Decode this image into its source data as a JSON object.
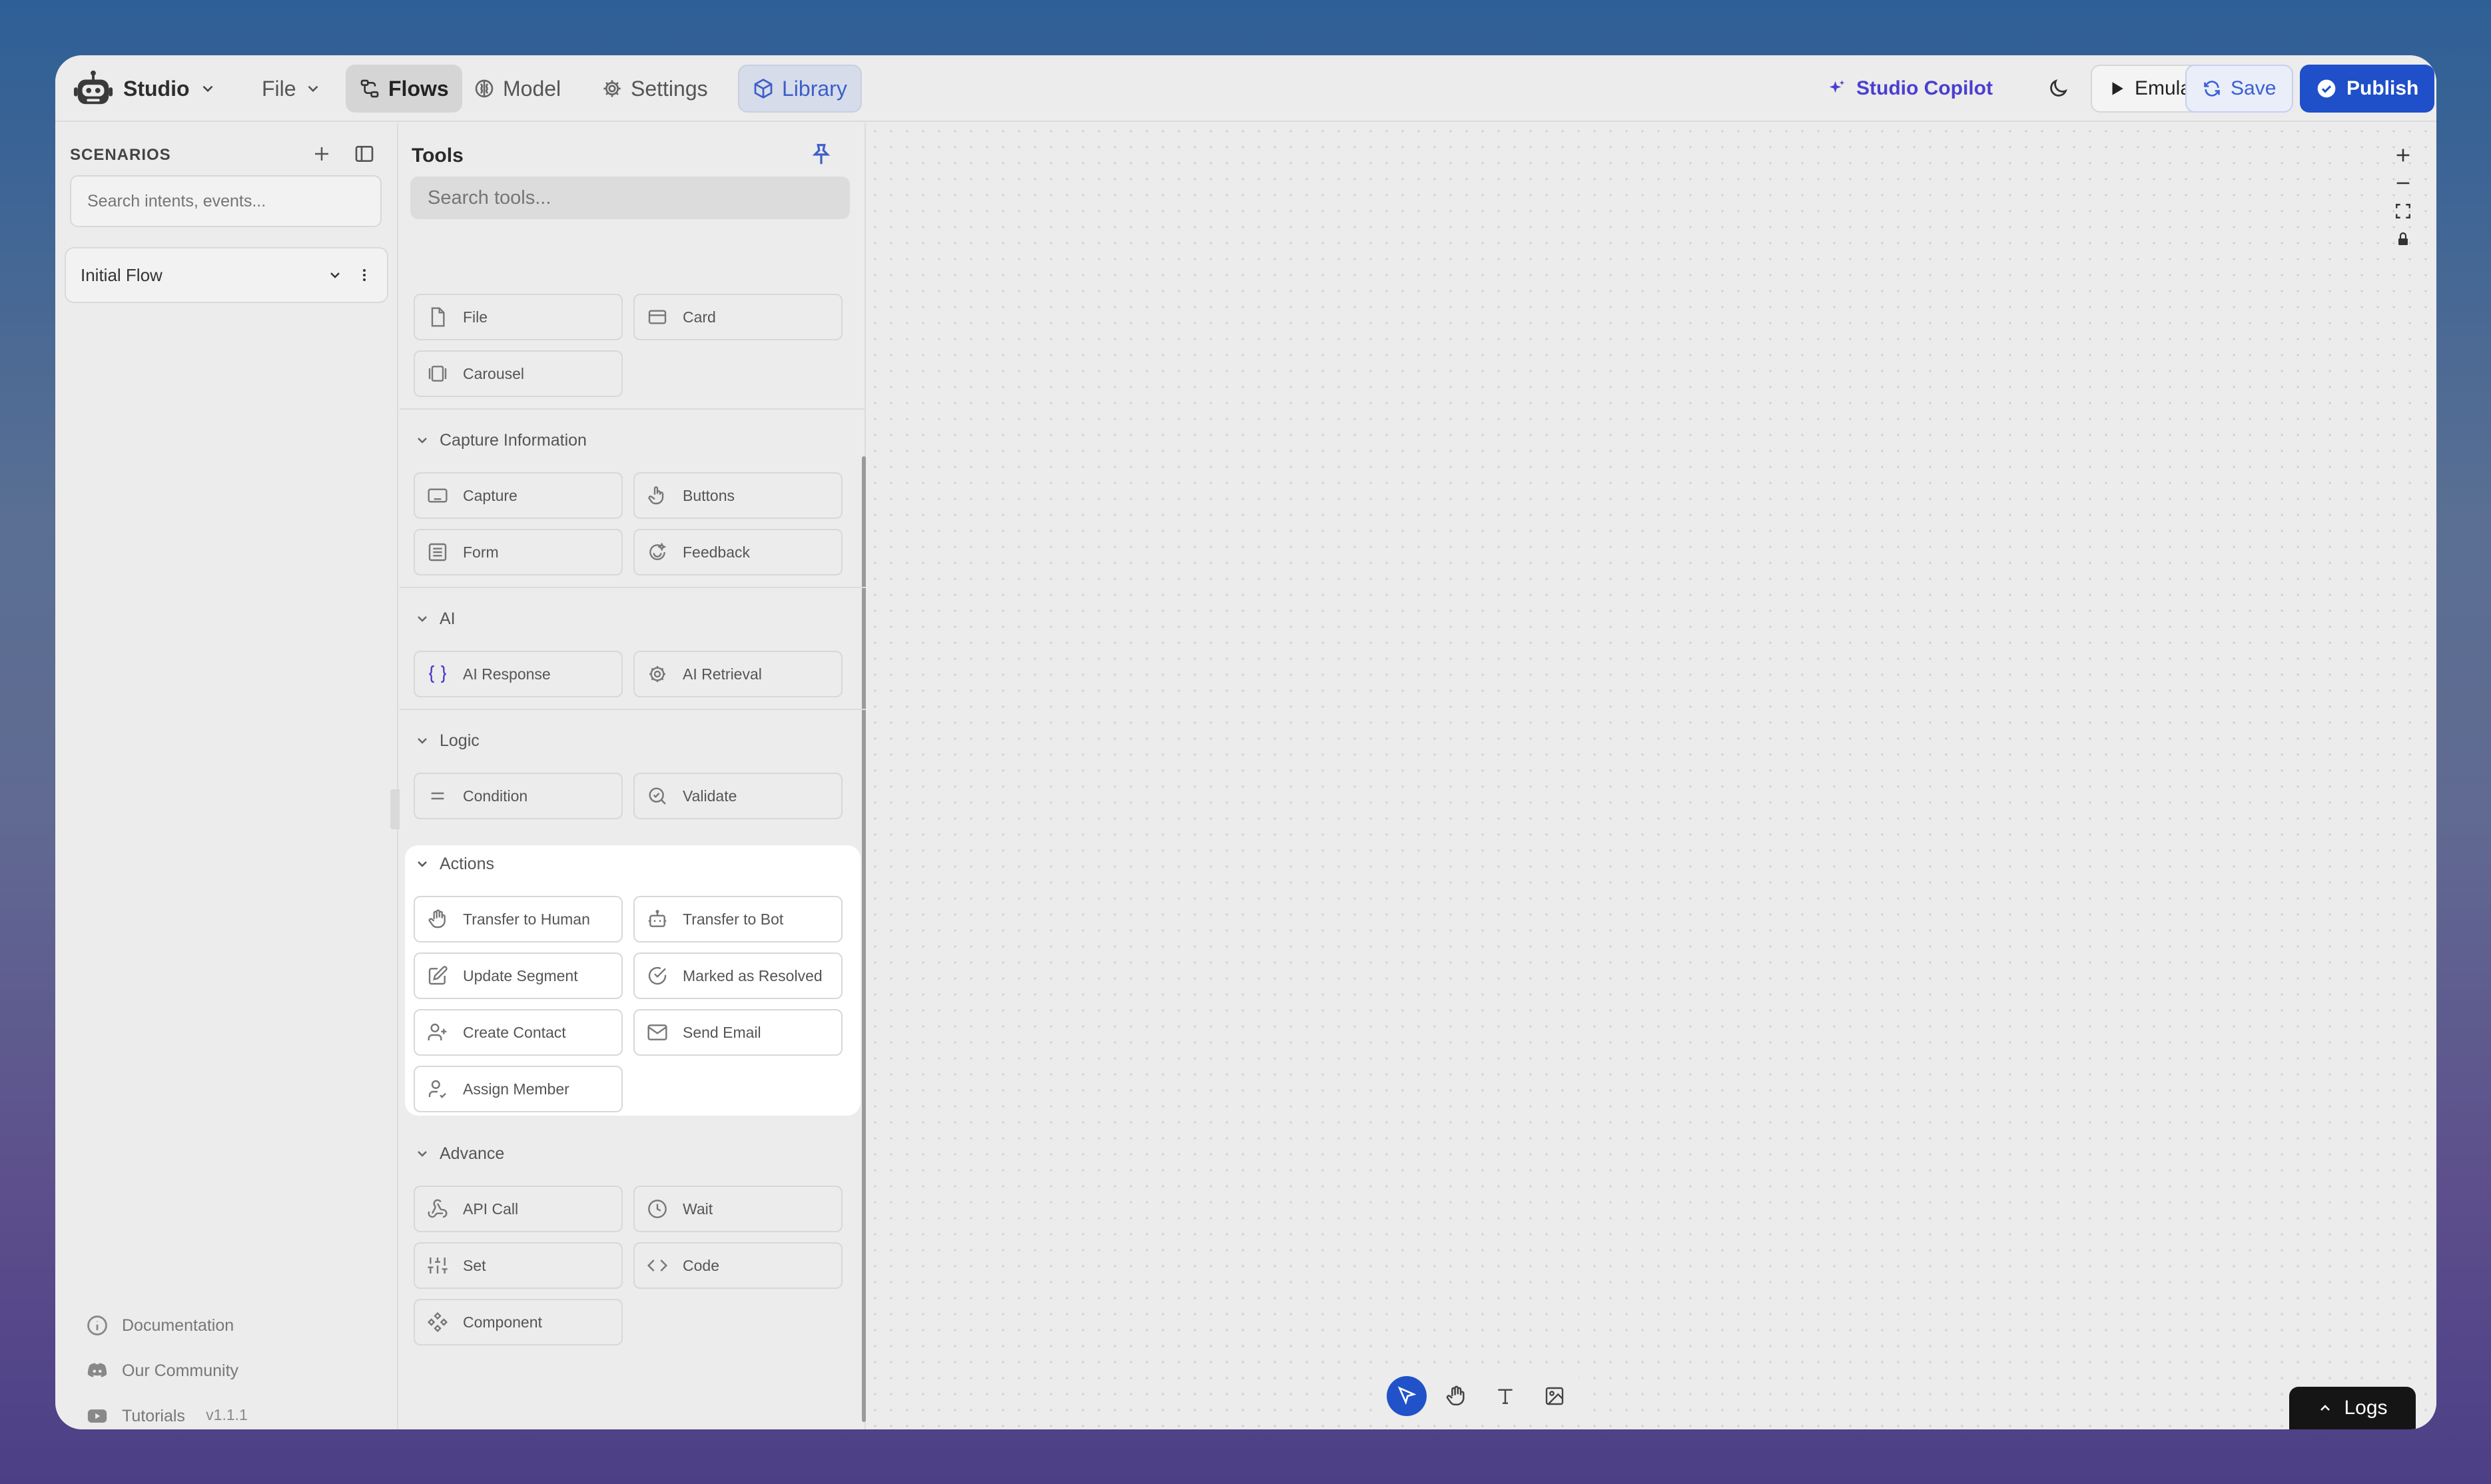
{
  "app": {
    "name": "Studio",
    "version": "v1.1.1"
  },
  "topbar": {
    "file_label": "File",
    "tabs": [
      {
        "label": "Flows",
        "icon": "flows-icon"
      },
      {
        "label": "Model",
        "icon": "brain-icon"
      },
      {
        "label": "Settings",
        "icon": "gear-icon"
      },
      {
        "label": "Library",
        "icon": "package-icon"
      }
    ],
    "copilot_label": "Studio Copilot",
    "emulator_label": "Emulator",
    "save_label": "Save",
    "publish_label": "Publish",
    "accent_color": "#1f4fc9",
    "copilot_color": "#4b3fcf"
  },
  "sidebar": {
    "title": "SCENARIOS",
    "search_placeholder": "Search intents, events...",
    "flows": [
      {
        "label": "Initial Flow"
      }
    ],
    "links": [
      {
        "label": "Documentation",
        "icon": "info-icon"
      },
      {
        "label": "Our Community",
        "icon": "discord-icon"
      },
      {
        "label": "Tutorials",
        "icon": "youtube-icon"
      }
    ]
  },
  "tools": {
    "title": "Tools",
    "search_placeholder": "Search tools...",
    "top_items": [
      {
        "label": "File",
        "icon": "file-icon"
      },
      {
        "label": "Card",
        "icon": "card-icon"
      },
      {
        "label": "Carousel",
        "icon": "carousel-icon"
      }
    ],
    "sections": [
      {
        "title": "Capture Information",
        "items": [
          {
            "label": "Capture",
            "icon": "keyboard-icon"
          },
          {
            "label": "Buttons",
            "icon": "pointer-hand-icon"
          },
          {
            "label": "Form",
            "icon": "form-icon"
          },
          {
            "label": "Feedback",
            "icon": "feedback-icon"
          }
        ]
      },
      {
        "title": "AI",
        "items": [
          {
            "label": "AI Response",
            "icon": "braces-icon"
          },
          {
            "label": "AI Retrieval",
            "icon": "retrieval-icon"
          }
        ]
      },
      {
        "title": "Logic",
        "items": [
          {
            "label": "Condition",
            "icon": "equals-icon"
          },
          {
            "label": "Validate",
            "icon": "search-check-icon"
          }
        ]
      },
      {
        "title": "Actions",
        "highlighted": true,
        "items": [
          {
            "label": "Transfer to Human",
            "icon": "hand-icon"
          },
          {
            "label": "Transfer to Bot",
            "icon": "bot-icon"
          },
          {
            "label": "Update Segment",
            "icon": "edit-icon"
          },
          {
            "label": "Marked as Resolved",
            "icon": "check-circle-icon"
          },
          {
            "label": "Create Contact",
            "icon": "user-plus-icon"
          },
          {
            "label": "Send Email",
            "icon": "mail-icon"
          },
          {
            "label": "Assign Member",
            "icon": "user-check-icon"
          }
        ]
      },
      {
        "title": "Advance",
        "items": [
          {
            "label": "API Call",
            "icon": "webhook-icon"
          },
          {
            "label": "Wait",
            "icon": "clock-icon"
          },
          {
            "label": "Set",
            "icon": "sliders-icon"
          },
          {
            "label": "Code",
            "icon": "code-icon"
          },
          {
            "label": "Component",
            "icon": "component-icon"
          }
        ]
      }
    ]
  },
  "canvas": {
    "logs_label": "Logs"
  }
}
